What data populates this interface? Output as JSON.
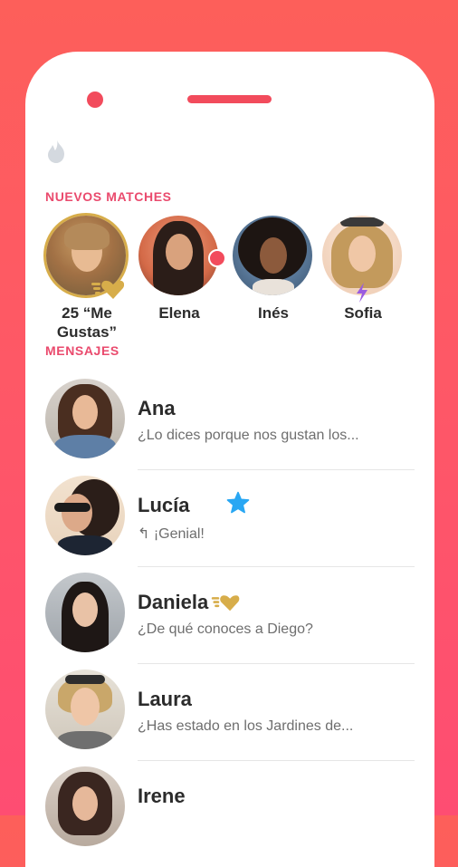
{
  "sections": {
    "new_matches": "NUEVOS MATCHES",
    "messages": "MENSAJES"
  },
  "matches": [
    {
      "name": "25 “Me Gustas”",
      "highlight": true
    },
    {
      "name": "Elena",
      "online": true
    },
    {
      "name": "Inés"
    },
    {
      "name": "Sofia",
      "boost": true
    }
  ],
  "conversations": [
    {
      "name": "Ana",
      "message": "¿Lo dices porque nos gustan los..."
    },
    {
      "name": "Lucía",
      "message": "↰ ¡Genial!",
      "badge": "super-like-star"
    },
    {
      "name": "Daniela",
      "message": "¿De qué conoces a Diego?",
      "badge": "gold-heart"
    },
    {
      "name": "Laura",
      "message": "¿Has estado en los Jardines de..."
    },
    {
      "name": "Irene",
      "message": ""
    }
  ],
  "colors": {
    "accent": "#fe5866",
    "section_title": "#ea4a6d",
    "gold": "#d7ad4a",
    "star": "#29a7f3",
    "boost": "#9a5ce0"
  },
  "icons": [
    "flame-icon",
    "gold-heart-icon",
    "star-icon",
    "bolt-icon",
    "reply-icon"
  ]
}
